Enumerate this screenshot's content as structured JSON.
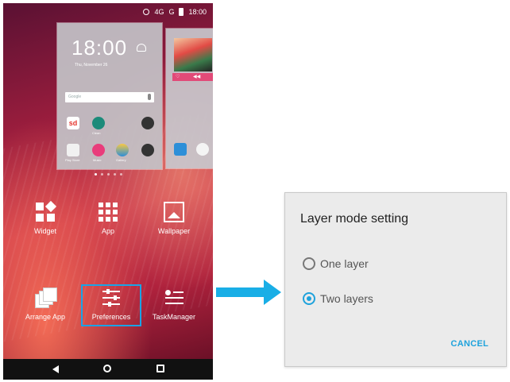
{
  "phone": {
    "status": {
      "network": "4G",
      "carrier": "G",
      "time": "18:00"
    },
    "preview": {
      "clock": "18:00",
      "date": "Thu, November 26",
      "search_placeholder": "Google",
      "apps_row1": [
        {
          "name": "sd",
          "label": ""
        },
        {
          "name": "clean-icon",
          "label": "Clean"
        },
        {
          "name": "folder-icon",
          "label": ""
        }
      ],
      "apps_row2": [
        {
          "name": "play-store-icon",
          "label": "Play Store"
        },
        {
          "name": "music-icon",
          "label": "Music"
        },
        {
          "name": "gallery-icon",
          "label": "Gallery"
        },
        {
          "name": "apps-folder-icon",
          "label": ""
        }
      ],
      "side_row": [
        {
          "name": "store-icon",
          "label": ""
        },
        {
          "name": "compass-icon",
          "label": ""
        }
      ]
    },
    "tools": {
      "widget": "Widget",
      "app": "App",
      "wallpaper": "Wallpaper",
      "arrange": "Arrange App",
      "preferences": "Preferences",
      "taskmanager": "TaskManager"
    }
  },
  "dialog": {
    "title": "Layer mode setting",
    "options": [
      {
        "label": "One layer",
        "checked": false
      },
      {
        "label": "Two layers",
        "checked": true
      }
    ],
    "cancel": "CANCEL"
  },
  "colors": {
    "accent": "#1ea2dc",
    "arrow": "#19aee6",
    "highlight": "#1aa3e6",
    "dialog_bg": "#ebebeb"
  }
}
